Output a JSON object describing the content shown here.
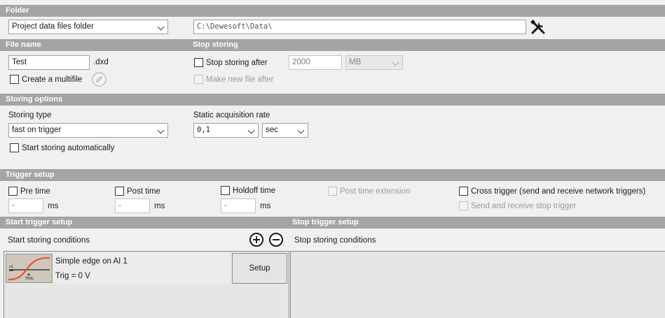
{
  "folder": {
    "header": "Folder",
    "folder_type": "Project data files folder",
    "path": "C:\\Dewesoft\\Data\\"
  },
  "file_name": {
    "header": "File name",
    "value": "Test",
    "extension": ".dxd",
    "multifile_label": "Create a multifile"
  },
  "stop_storing": {
    "header": "Stop storing",
    "stop_after_label": "Stop storing after",
    "size_value": "2000",
    "unit": "MB",
    "new_file_label": "Make new file after"
  },
  "storing_options": {
    "header": "Storing options",
    "storing_type_label": "Storing type",
    "storing_type_value": "fast on trigger",
    "auto_start_label": "Start storing automatically",
    "static_rate_label": "Static acquisition rate",
    "static_rate_value": "0,1",
    "static_rate_unit": "sec"
  },
  "trigger_setup": {
    "header": "Trigger setup",
    "pre_time_label": "Pre time",
    "pre_time_value": "-",
    "post_time_label": "Post time",
    "post_time_value": "-",
    "holdoff_label": "Holdoff time",
    "holdoff_value": "-",
    "unit_ms": "ms",
    "post_ext_label": "Post time extension",
    "cross_trigger_label": "Cross trigger (send and receive network triggers)",
    "stop_trigger_label": "Send and receive stop trigger"
  },
  "start_trigger": {
    "header": "Start trigger setup",
    "conditions_label": "Start storing conditions",
    "item_title": "Simple edge on AI 1",
    "item_detail": "Trig = 0 V",
    "setup_button": "Setup",
    "thumb_label": "TRIG"
  },
  "stop_trigger": {
    "header": "Stop trigger setup",
    "conditions_label": "Stop storing conditions"
  },
  "colors": {
    "header_bg": "#a4a4a4",
    "trigger_curve": "#e8542a"
  }
}
